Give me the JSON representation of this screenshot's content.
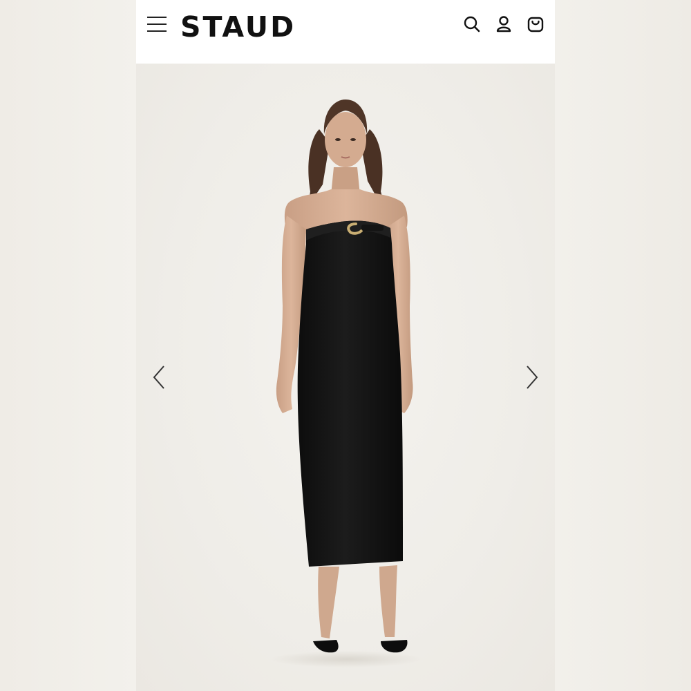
{
  "header": {
    "brand": "STAUD",
    "icons": [
      "menu-icon",
      "search-icon",
      "account-icon",
      "cart-icon"
    ]
  },
  "product_gallery": {
    "image": "model-in-black-strapless-midi-dress",
    "prev_icon": "chevron-left-icon",
    "next_icon": "chevron-right-icon"
  },
  "colors": {
    "header_bg": "#ffffff",
    "page_bg": "#efede8",
    "text": "#111111",
    "dress": "#131313",
    "buckle": "#c9ae73"
  }
}
